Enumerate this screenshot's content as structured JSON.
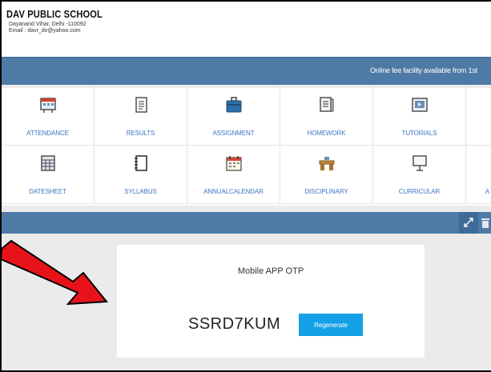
{
  "header": {
    "school_name": "DAV PUBLIC SCHOOL",
    "address": "Dayanand Vihar, Delhi -110092",
    "email": "Email : davr_dv@yahoo.com"
  },
  "banner": {
    "text": "Online fee facility available from 1st"
  },
  "tiles": [
    {
      "label": "ATTENDANCE",
      "icon": "calendar-board-icon"
    },
    {
      "label": "RESULTS",
      "icon": "document-list-icon"
    },
    {
      "label": "ASSIGNMENT",
      "icon": "briefcase-icon"
    },
    {
      "label": "HOMEWORK",
      "icon": "notebook-icon"
    },
    {
      "label": "TUTORIALS",
      "icon": "video-player-icon"
    },
    {
      "label": "",
      "icon": ""
    },
    {
      "label": "DATESHEET",
      "icon": "datasheet-grid-icon"
    },
    {
      "label": "SYLLABUS",
      "icon": "binder-icon"
    },
    {
      "label": "ANNUALCALENDAR",
      "icon": "wall-calendar-icon"
    },
    {
      "label": "DISCIPLINARY",
      "icon": "desk-icon"
    },
    {
      "label": "CURRICULAR",
      "icon": "easel-board-icon"
    },
    {
      "label": "A",
      "icon": ""
    }
  ],
  "toolbar": {
    "expand_icon": "expand-arrows-icon",
    "trash_icon": "trash-icon"
  },
  "otp": {
    "title": "Mobile APP OTP",
    "code": "SSRD7KUM",
    "button_label": "Regenerate"
  },
  "colors": {
    "banner": "#4e7aa6",
    "tile_label": "#3e74c4",
    "button": "#14a0e6",
    "arrow": "#e8131a"
  }
}
